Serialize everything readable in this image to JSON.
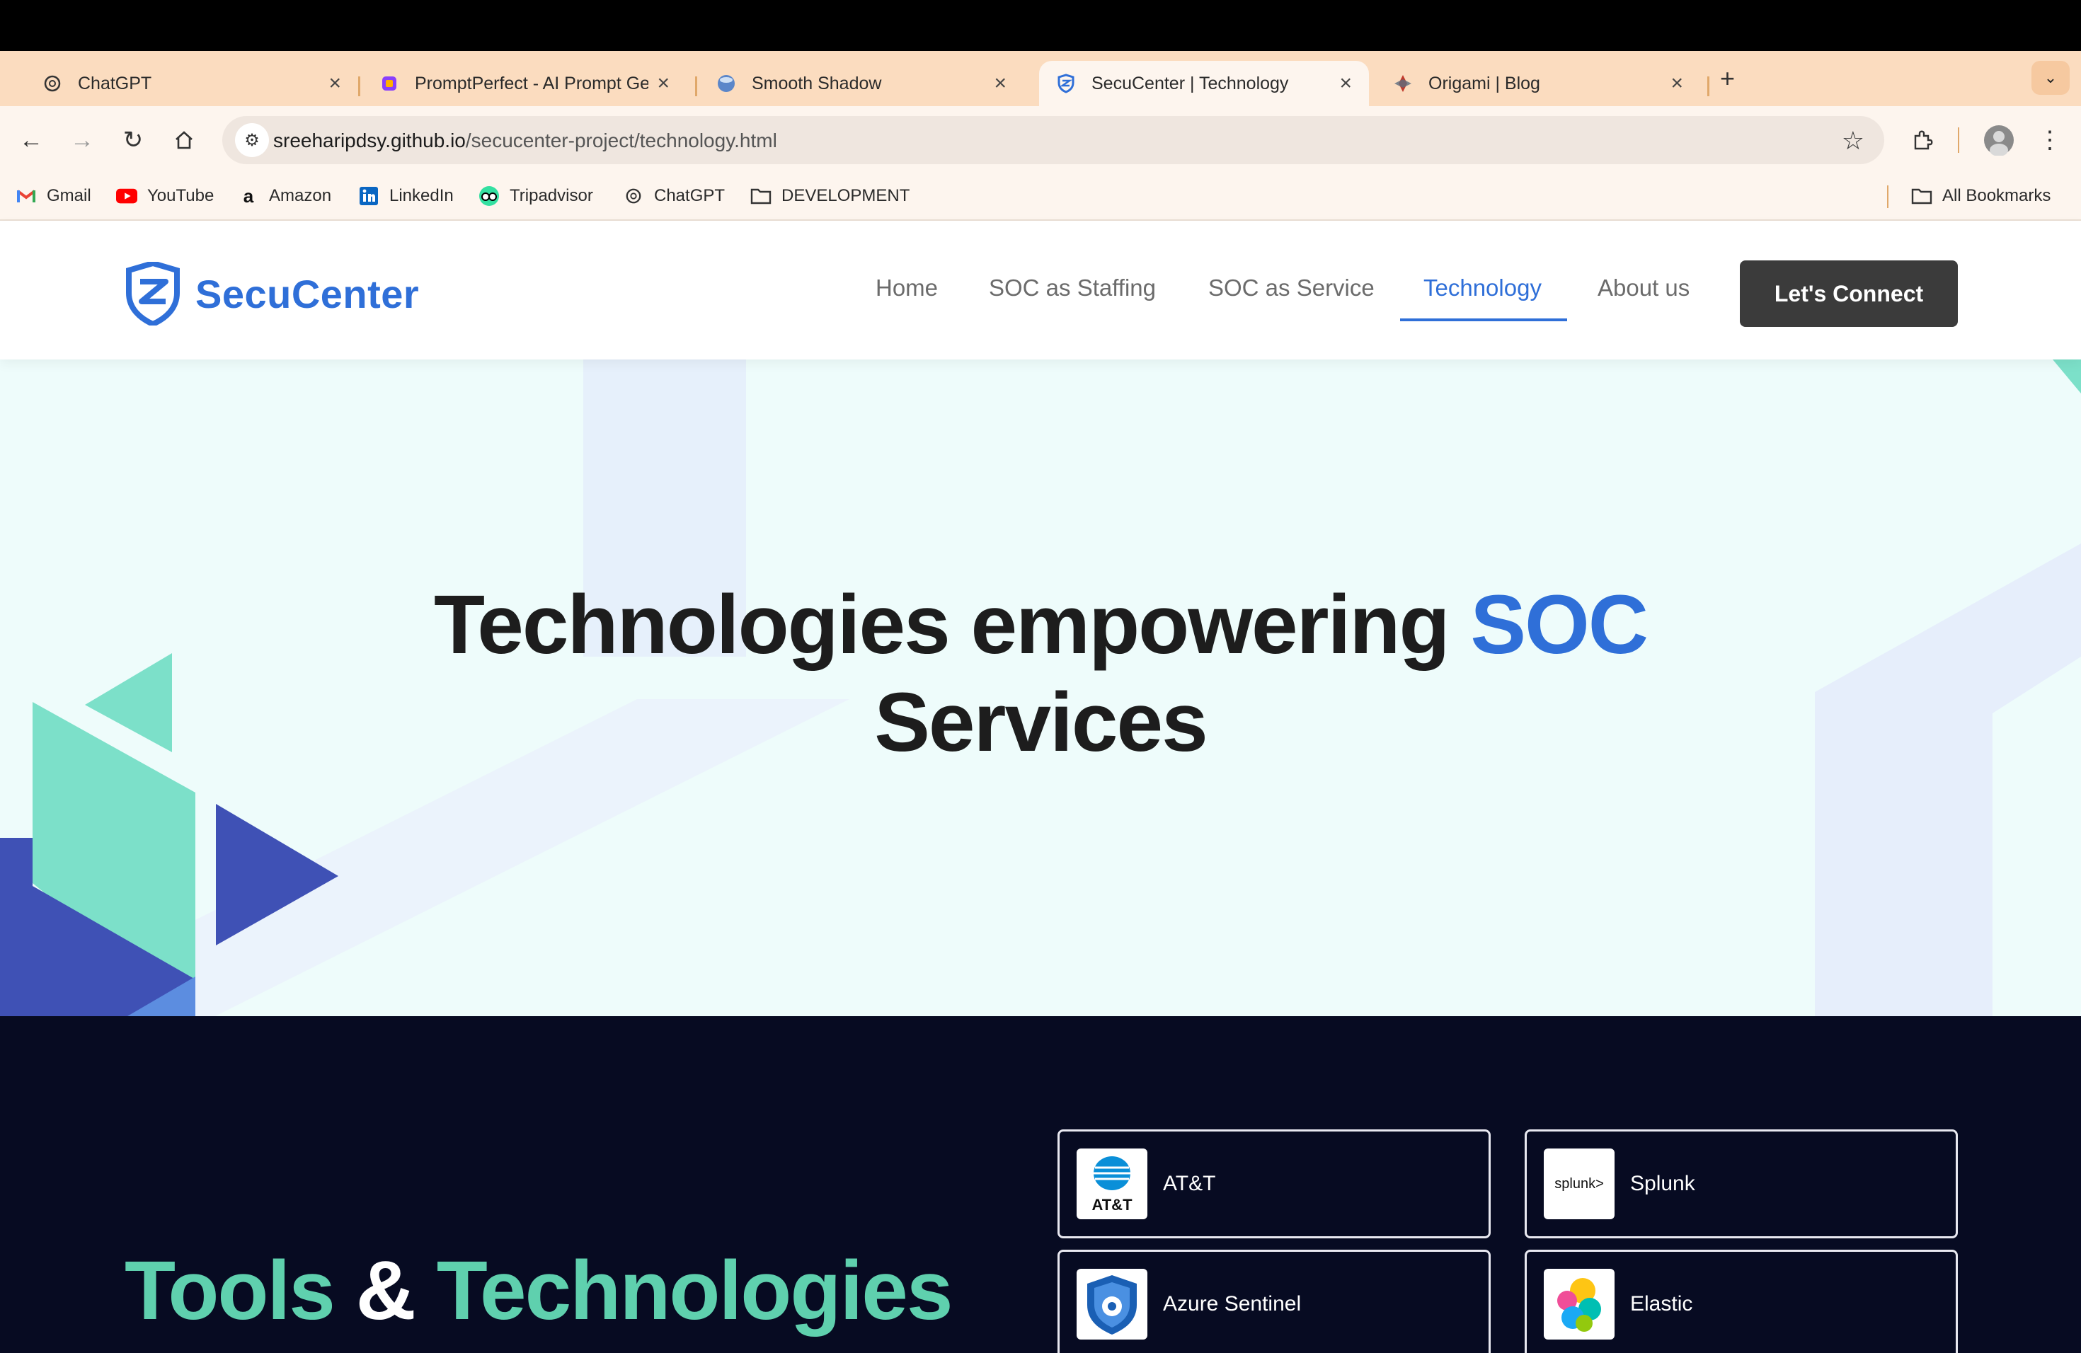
{
  "browser": {
    "tabs": [
      {
        "label": "ChatGPT",
        "icon": "chatgpt-icon"
      },
      {
        "label": "PromptPerfect - AI Prompt Ge",
        "icon": "promptperfect-icon"
      },
      {
        "label": "Smooth Shadow",
        "icon": "smooth-shadow-icon"
      },
      {
        "label": "SecuCenter | Technology",
        "icon": "secucenter-icon",
        "active": true
      },
      {
        "label": "Origami | Blog",
        "icon": "origami-icon"
      }
    ],
    "address": {
      "domain": "sreeharipdsy.github.io",
      "path": "/secucenter-project/technology.html"
    },
    "bookmarks": [
      {
        "label": "Gmail",
        "icon": "gmail-icon"
      },
      {
        "label": "YouTube",
        "icon": "youtube-icon"
      },
      {
        "label": "Amazon",
        "icon": "amazon-icon"
      },
      {
        "label": "LinkedIn",
        "icon": "linkedin-icon"
      },
      {
        "label": "Tripadvisor",
        "icon": "tripadvisor-icon"
      },
      {
        "label": "ChatGPT",
        "icon": "chatgpt-icon"
      },
      {
        "label": "DEVELOPMENT",
        "icon": "folder-icon"
      }
    ],
    "all_bookmarks": "All Bookmarks"
  },
  "site": {
    "logo_text": "SecuCenter",
    "nav": [
      {
        "label": "Home"
      },
      {
        "label": "SOC as Staffing"
      },
      {
        "label": "SOC as Service"
      },
      {
        "label": "Technology",
        "active": true
      },
      {
        "label": "About us"
      }
    ],
    "cta": "Let's Connect"
  },
  "hero": {
    "title_part1": "Technologies empowering ",
    "title_highlight": "SOC",
    "title_part2": "Services"
  },
  "tools": {
    "title_word1": "Tools",
    "title_amp": " & ",
    "title_word2": "Technologies",
    "cards": [
      {
        "label": "AT&T",
        "icon_text": "AT&T"
      },
      {
        "label": "Splunk",
        "icon_text": "splunk>"
      },
      {
        "label": "Azure Sentinel"
      },
      {
        "label": "Elastic"
      }
    ]
  },
  "colors": {
    "brand_blue": "#2f6fd8",
    "accent_green": "#5fd0ae",
    "dark_bg": "#070b22",
    "hero_bg": "#eefcfb"
  }
}
